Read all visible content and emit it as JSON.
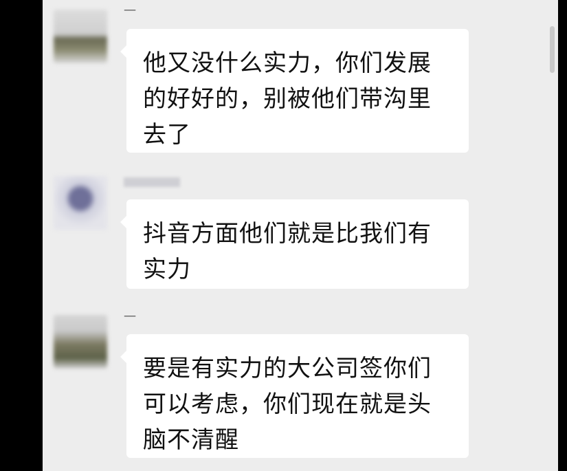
{
  "chat": {
    "messages": [
      {
        "sender": "一",
        "text": "他又没什么实力，你们发展的好好的，别被他们带沟里去了"
      },
      {
        "sender": "",
        "text": "抖音方面他们就是比我们有实力"
      },
      {
        "sender": "一",
        "text": "要是有实力的大公司签你们可以考虑，你们现在就是头脑不清醒"
      }
    ]
  }
}
